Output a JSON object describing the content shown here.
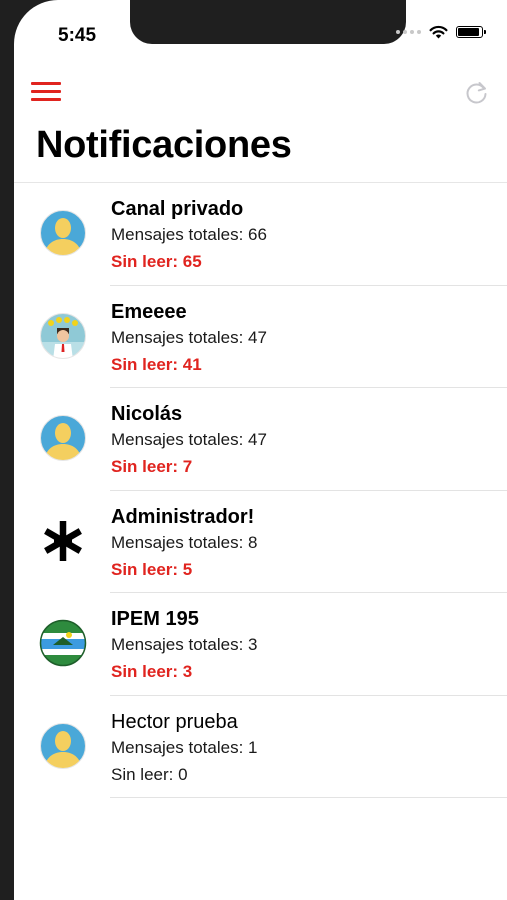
{
  "status_bar": {
    "time": "5:45"
  },
  "header": {
    "title": "Notificaciones"
  },
  "colors": {
    "accent": "#e0241f"
  },
  "icons": {
    "menu": "hamburger-menu-icon",
    "refresh": "refresh-icon"
  },
  "channels": [
    {
      "name": "Canal privado",
      "total": "Mensajes totales: 66",
      "unread": "Sin leer: 65",
      "avatar": "default-user-avatar"
    },
    {
      "name": "Emeeee",
      "total": "Mensajes totales: 47",
      "unread": "Sin leer: 41",
      "avatar": "cartoon-avatar"
    },
    {
      "name": "Nicolás",
      "total": "Mensajes totales: 47",
      "unread": "Sin leer: 7",
      "avatar": "default-user-avatar"
    },
    {
      "name": "Administrador!",
      "total": "Mensajes totales: 8",
      "unread": "Sin leer: 5",
      "avatar": "asterisk-logo"
    },
    {
      "name": "IPEM 195",
      "total": "Mensajes totales: 3",
      "unread": "Sin leer: 3",
      "avatar": "school-emblem"
    },
    {
      "name": "Hector prueba",
      "total": "Mensajes totales: 1",
      "unread": "Sin leer: 0",
      "avatar": "default-user-avatar"
    }
  ]
}
